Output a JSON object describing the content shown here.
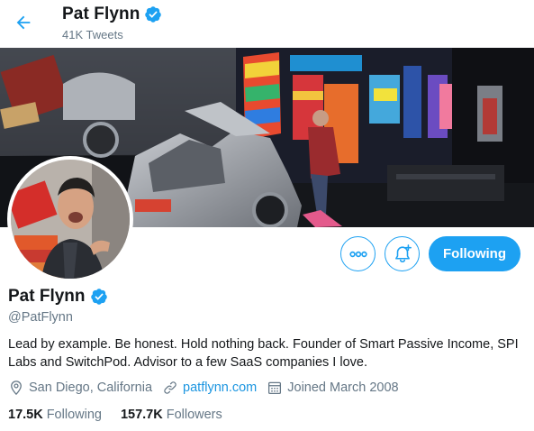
{
  "header": {
    "name": "Pat Flynn",
    "tweet_count": "41K Tweets",
    "back_icon": "arrow-left-icon"
  },
  "profile": {
    "name": "Pat Flynn",
    "handle": "@PatFlynn",
    "verified": true,
    "bio": "Lead by example. Be honest. Hold nothing back. Founder of Smart Passive Income, SPI Labs and SwitchPod. Advisor to a few SaaS companies I love.",
    "location": "San Diego, California",
    "website": "patflynn.com",
    "joined": "Joined March 2008"
  },
  "actions": {
    "more_icon": "more-icon",
    "notify_icon": "bell-plus-icon",
    "following_label": "Following"
  },
  "stats": {
    "following_count": "17.5K",
    "following_label": "Following",
    "followers_count": "157.7K",
    "followers_label": "Followers"
  },
  "colors": {
    "accent": "#1da1f2",
    "secondary_text": "#657786",
    "primary_text": "#14171a",
    "link": "#1b95e0"
  }
}
